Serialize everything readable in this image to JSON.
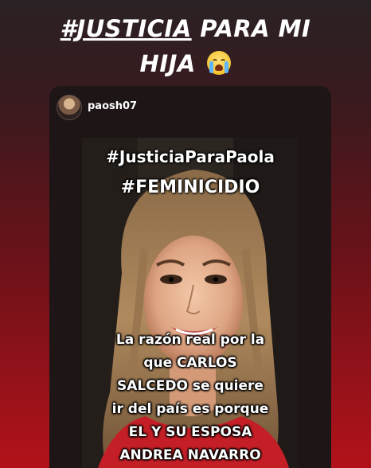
{
  "caption": {
    "hashtag": "#JUSTICIA",
    "rest_line1": "PARA MI",
    "line2": "HIJA",
    "emoji": "loudly-crying-face"
  },
  "repost": {
    "username": "paosh07",
    "image": {
      "hashtag1": "#JusticiaParaPaola",
      "hashtag2": "#FEMINICIDIO",
      "text_lines": [
        "La razón real por la",
        "que CARLOS",
        "SALCEDO se quiere",
        "ir del país es porque",
        "EL Y SU ESPOSA",
        "ANDREA NAVARRO"
      ]
    }
  },
  "colors": {
    "background_top": "#2a2224",
    "background_bottom": "#b3121a",
    "card": "#1d1516",
    "text": "#ffffff"
  }
}
